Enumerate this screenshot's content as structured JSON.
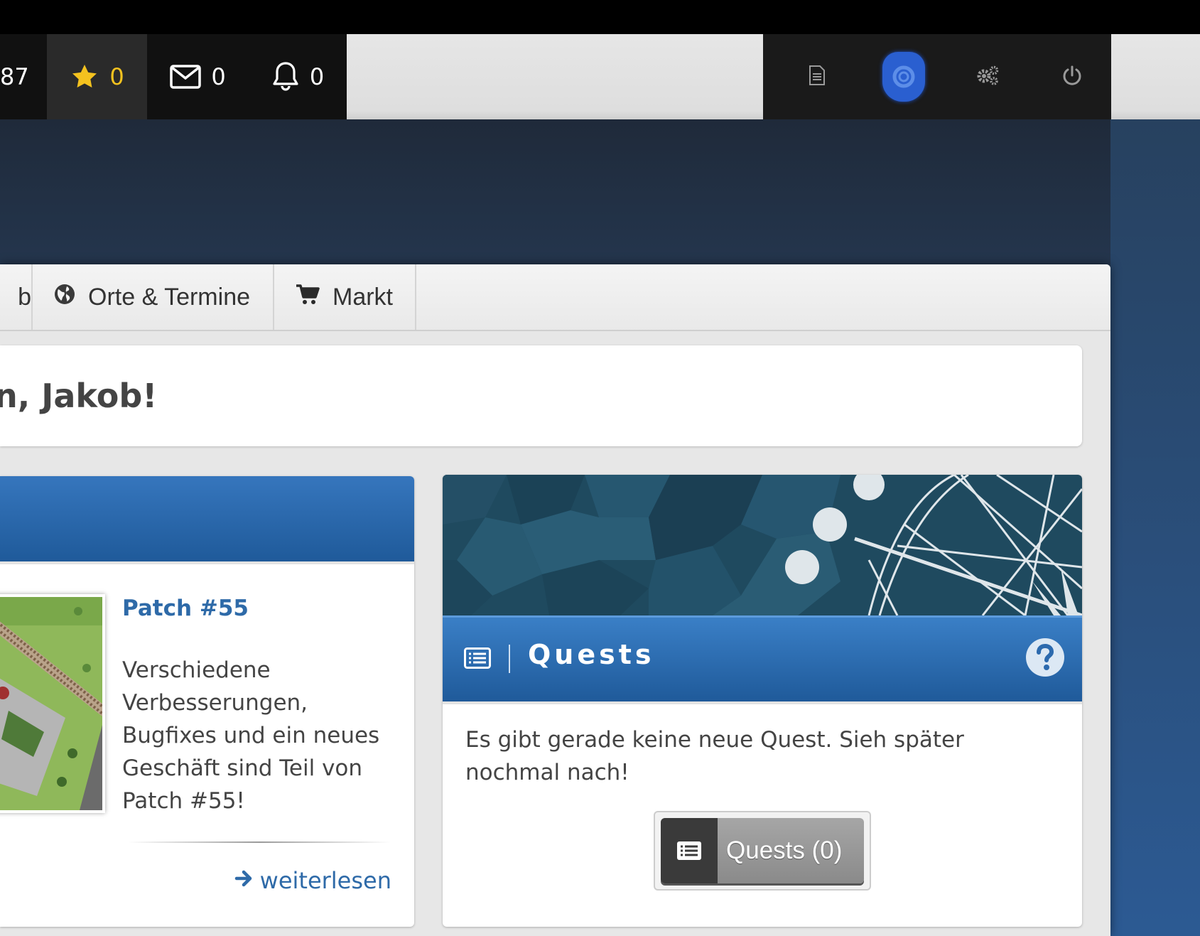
{
  "topbar": {
    "coins_partial": "87",
    "favorites_count": "0",
    "messages_count": "0",
    "notifications_count": "0",
    "favorite_color": "#f4c21f"
  },
  "toolbar": {
    "icons": [
      "document-icon",
      "help-lifebuoy-icon",
      "gears-icon",
      "power-icon"
    ]
  },
  "tabs": {
    "clipped_label": "b",
    "places_label": "Orte & Termine",
    "market_label": "Markt"
  },
  "greeting": {
    "text": "n, Jakob!"
  },
  "news": {
    "title": "Patch #55",
    "body": "Verschiedene Verbesserungen, Bugfixes und ein neues Geschäft sind Teil von Patch #55!",
    "read_more": "weiterlesen"
  },
  "quests": {
    "title": "Quests",
    "message": "Es gibt gerade keine neue Quest. Sieh später nochmal nach!",
    "button_label": "Quests (0)",
    "accent_color": "#2c6aae"
  }
}
